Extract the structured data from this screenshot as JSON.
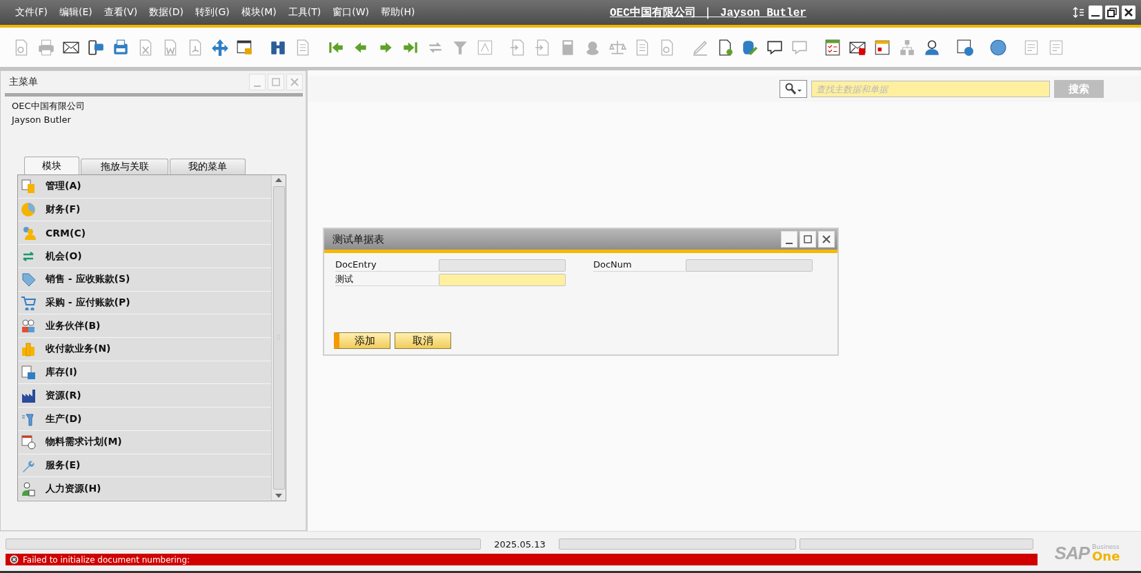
{
  "window": {
    "title": "OEC中国有限公司 ｜ Jayson Butler"
  },
  "menu_bar": [
    "文件(F)",
    "编辑(E)",
    "查看(V)",
    "数据(D)",
    "转到(G)",
    "模块(M)",
    "工具(T)",
    "窗口(W)",
    "帮助(H)"
  ],
  "toolbar": [
    [
      {
        "disabled": true
      },
      {
        "disabled": true
      },
      {
        "disabled": false
      },
      {
        "disabled": false
      },
      {
        "disabled": false
      },
      {
        "disabled": true
      },
      {
        "disabled": true
      },
      {
        "disabled": true
      },
      {
        "disabled": false
      },
      {
        "disabled": false
      }
    ],
    [
      {
        "disabled": false
      },
      {
        "disabled": true
      }
    ],
    [
      {
        "disabled": false
      },
      {
        "disabled": false
      },
      {
        "disabled": false
      },
      {
        "disabled": false
      },
      {
        "disabled": true
      },
      {
        "disabled": true
      },
      {
        "disabled": true
      }
    ],
    [
      {
        "disabled": true
      },
      {
        "disabled": true
      },
      {
        "disabled": true
      },
      {
        "disabled": true
      },
      {
        "disabled": true
      },
      {
        "disabled": true
      },
      {
        "disabled": true
      }
    ],
    [
      {
        "disabled": true
      },
      {
        "disabled": false
      },
      {
        "disabled": false
      },
      {
        "disabled": false
      },
      {
        "disabled": true
      }
    ],
    [
      {
        "disabled": false
      },
      {
        "disabled": false
      },
      {
        "disabled": false
      },
      {
        "disabled": true
      },
      {
        "disabled": false
      }
    ],
    [
      {
        "disabled": false
      }
    ],
    [
      {
        "disabled": false
      }
    ],
    [
      {
        "disabled": true
      },
      {
        "disabled": true
      }
    ]
  ],
  "main_menu": {
    "title": "主菜单",
    "company": "OEC中国有限公司",
    "user": "Jayson Butler",
    "tabs": [
      {
        "label": "模块",
        "selected": true
      },
      {
        "label": "拖放与关联",
        "selected": false
      },
      {
        "label": "我的菜单",
        "selected": false
      }
    ],
    "items": [
      "管理(A)",
      "财务(F)",
      "CRM(C)",
      "机会(O)",
      "销售 - 应收账款(S)",
      "采购 - 应付账款(P)",
      "业务伙伴(B)",
      "收付款业务(N)",
      "库存(I)",
      "资源(R)",
      "生产(D)",
      "物料需求计划(M)",
      "服务(E)",
      "人力资源(H)"
    ]
  },
  "search": {
    "placeholder": "查找主数据和单据",
    "button": "搜索"
  },
  "dialog": {
    "title": "测试单据表",
    "fields": [
      {
        "label": "DocEntry",
        "kind": "readonly"
      },
      {
        "label": "DocNum",
        "kind": "readonly"
      },
      {
        "label": "测试",
        "kind": "editable"
      }
    ],
    "buttons": [
      {
        "label": "添加",
        "default": true
      },
      {
        "label": "取消",
        "default": false
      }
    ]
  },
  "status_bar": {
    "date": "2025.05.13",
    "message": "Failed to initialize document numbering:",
    "error": true
  },
  "logo": {
    "brand": "SAP",
    "line1": "Business",
    "line2": "One"
  }
}
